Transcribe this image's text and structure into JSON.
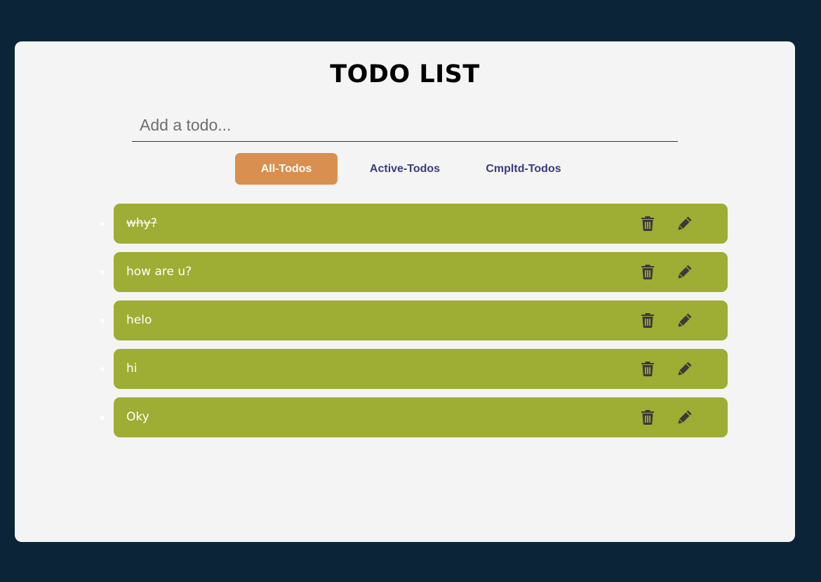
{
  "app": {
    "title": "TODO LIST"
  },
  "input": {
    "placeholder": "Add a todo...",
    "value": ""
  },
  "filters": [
    {
      "label": "All-Todos",
      "active": true
    },
    {
      "label": "Active-Todos",
      "active": false
    },
    {
      "label": "Cmpltd-Todos",
      "active": false
    }
  ],
  "todos": [
    {
      "text": "why?",
      "completed": true
    },
    {
      "text": "how are u?",
      "completed": false
    },
    {
      "text": "helo",
      "completed": false
    },
    {
      "text": "hi",
      "completed": false
    },
    {
      "text": "Oky",
      "completed": false
    }
  ],
  "icons": {
    "delete": "trash-icon",
    "edit": "pencil-icon"
  },
  "colors": {
    "background": "#0b2437",
    "card": "#f4f4f4",
    "active_filter": "#d98f4f",
    "filter_text": "#3b3b7c",
    "todo_item": "#9ead33",
    "icon": "#3a3a3a"
  }
}
